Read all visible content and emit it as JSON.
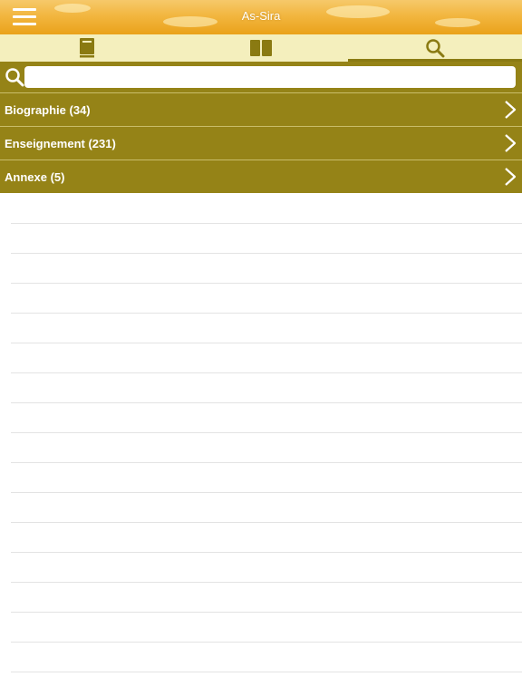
{
  "header": {
    "title": "As-Sira",
    "menu_icon": "hamburger-menu-icon"
  },
  "tabs": [
    {
      "name": "book",
      "icon": "book-icon",
      "active": false
    },
    {
      "name": "reading",
      "icon": "open-book-icon",
      "active": false
    },
    {
      "name": "search",
      "icon": "search-icon",
      "active": true
    }
  ],
  "search": {
    "value": "",
    "placeholder": "",
    "icon": "search-icon"
  },
  "categories": [
    {
      "label": "Biographie (34)"
    },
    {
      "label": "Enseignement (231)"
    },
    {
      "label": "Annexe (5)"
    }
  ],
  "colors": {
    "header_gradient_top": "#f6c96a",
    "header_gradient_bottom": "#eaa21a",
    "tabbar_background": "#f4efbd",
    "accent_olive": "#958317",
    "text_light": "#ffffff"
  }
}
